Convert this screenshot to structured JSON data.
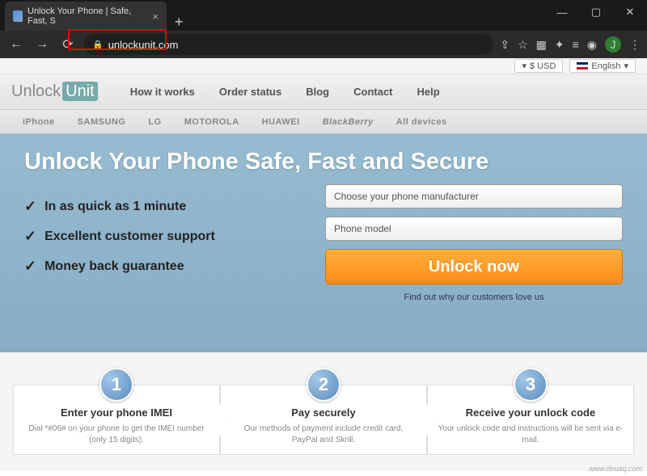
{
  "browser": {
    "tab_title": "Unlock Your Phone | Safe, Fast, S",
    "url": "unlockunit.com",
    "profile_initial": "J"
  },
  "topbar": {
    "currency": "$ USD",
    "language": "English"
  },
  "logo": {
    "part1": "Unlock",
    "part2": "Unit"
  },
  "nav": {
    "how": "How it works",
    "order": "Order status",
    "blog": "Blog",
    "contact": "Contact",
    "help": "Help"
  },
  "brands": {
    "iphone": "iPhone",
    "samsung": "SAMSUNG",
    "lg": "LG",
    "motorola": "MOTOROLA",
    "huawei": "HUAWEI",
    "blackberry": "BlackBerry",
    "all": "All devices"
  },
  "hero": {
    "headline": "Unlock Your Phone Safe, Fast and Secure",
    "benefits": {
      "b1": "In as quick as 1 minute",
      "b2": "Excellent customer support",
      "b3": "Money back guarantee"
    },
    "manufacturer_placeholder": "Choose your phone manufacturer",
    "model_placeholder": "Phone model",
    "cta": "Unlock now",
    "findout": "Find out why our customers love us"
  },
  "steps": {
    "s1": {
      "num": "1",
      "title": "Enter your phone IMEI",
      "desc": "Dial *#06# on your phone to get the IMEI number (only 15 digits)."
    },
    "s2": {
      "num": "2",
      "title": "Pay securely",
      "desc": "Our methods of payment include credit card, PayPal and Skrill."
    },
    "s3": {
      "num": "3",
      "title": "Receive your unlock code",
      "desc": "Your unlock code and instructions will be sent via e-mail."
    }
  },
  "watermark": "www.deuaq.com"
}
